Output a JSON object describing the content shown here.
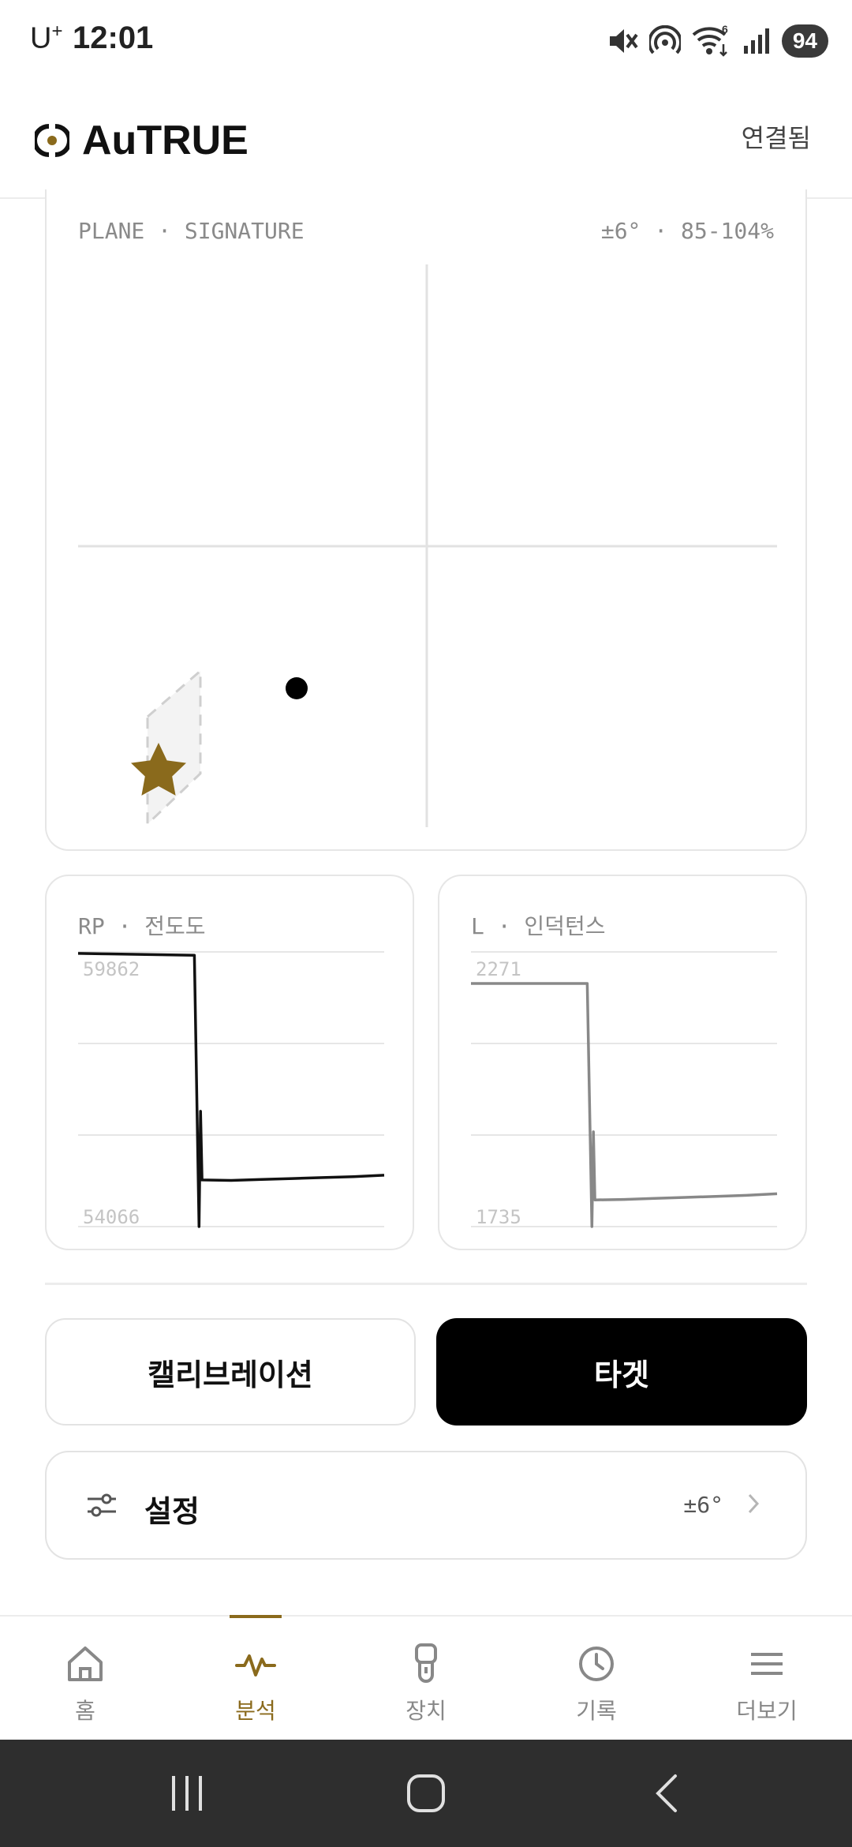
{
  "status_bar": {
    "carrier": "U",
    "carrier_sup": "+",
    "time": "12:01",
    "battery": "94",
    "wifi_badge": "6"
  },
  "header": {
    "app_name": "AuTRUE",
    "connection_status": "연결됨"
  },
  "plane": {
    "title": "PLANE · SIGNATURE",
    "range": "±6° · 85-104%"
  },
  "rp_chart": {
    "title": "RP · 전도도",
    "y_max_label": "59862",
    "y_min_label": "54066"
  },
  "l_chart": {
    "title": "L · 인덕턴스",
    "y_max_label": "2271",
    "y_min_label": "1735"
  },
  "chart_data": [
    {
      "type": "line",
      "title": "RP · 전도도",
      "ylim": [
        54066,
        59862
      ],
      "series": [
        {
          "values": [
            59830,
            59820,
            59810,
            59800,
            59790,
            54066,
            56500,
            55050,
            55040,
            55060,
            55080,
            55100,
            55120,
            55150
          ]
        }
      ],
      "color": "#111111"
    },
    {
      "type": "line",
      "title": "L · 인덕턴스",
      "ylim": [
        1735,
        2271
      ],
      "series": [
        {
          "values": [
            2271,
            2271,
            2271,
            2271,
            2271,
            1735,
            1920,
            1787,
            1788,
            1790,
            1792,
            1794,
            1796,
            1799
          ]
        }
      ],
      "color": "#888888"
    }
  ],
  "actions": {
    "calibration_label": "캘리브레이션",
    "target_label": "타겟"
  },
  "settings": {
    "label": "설정",
    "value": "±6°"
  },
  "bottom_nav": {
    "items": [
      {
        "label": "홈",
        "icon": "home-icon"
      },
      {
        "label": "분석",
        "icon": "pulse-icon",
        "active": true
      },
      {
        "label": "장치",
        "icon": "device-icon"
      },
      {
        "label": "기록",
        "icon": "clock-icon"
      },
      {
        "label": "더보기",
        "icon": "menu-icon"
      }
    ]
  },
  "colors": {
    "accent": "#8a6a1c",
    "primary": "#000000",
    "border": "#e6e6e6"
  }
}
